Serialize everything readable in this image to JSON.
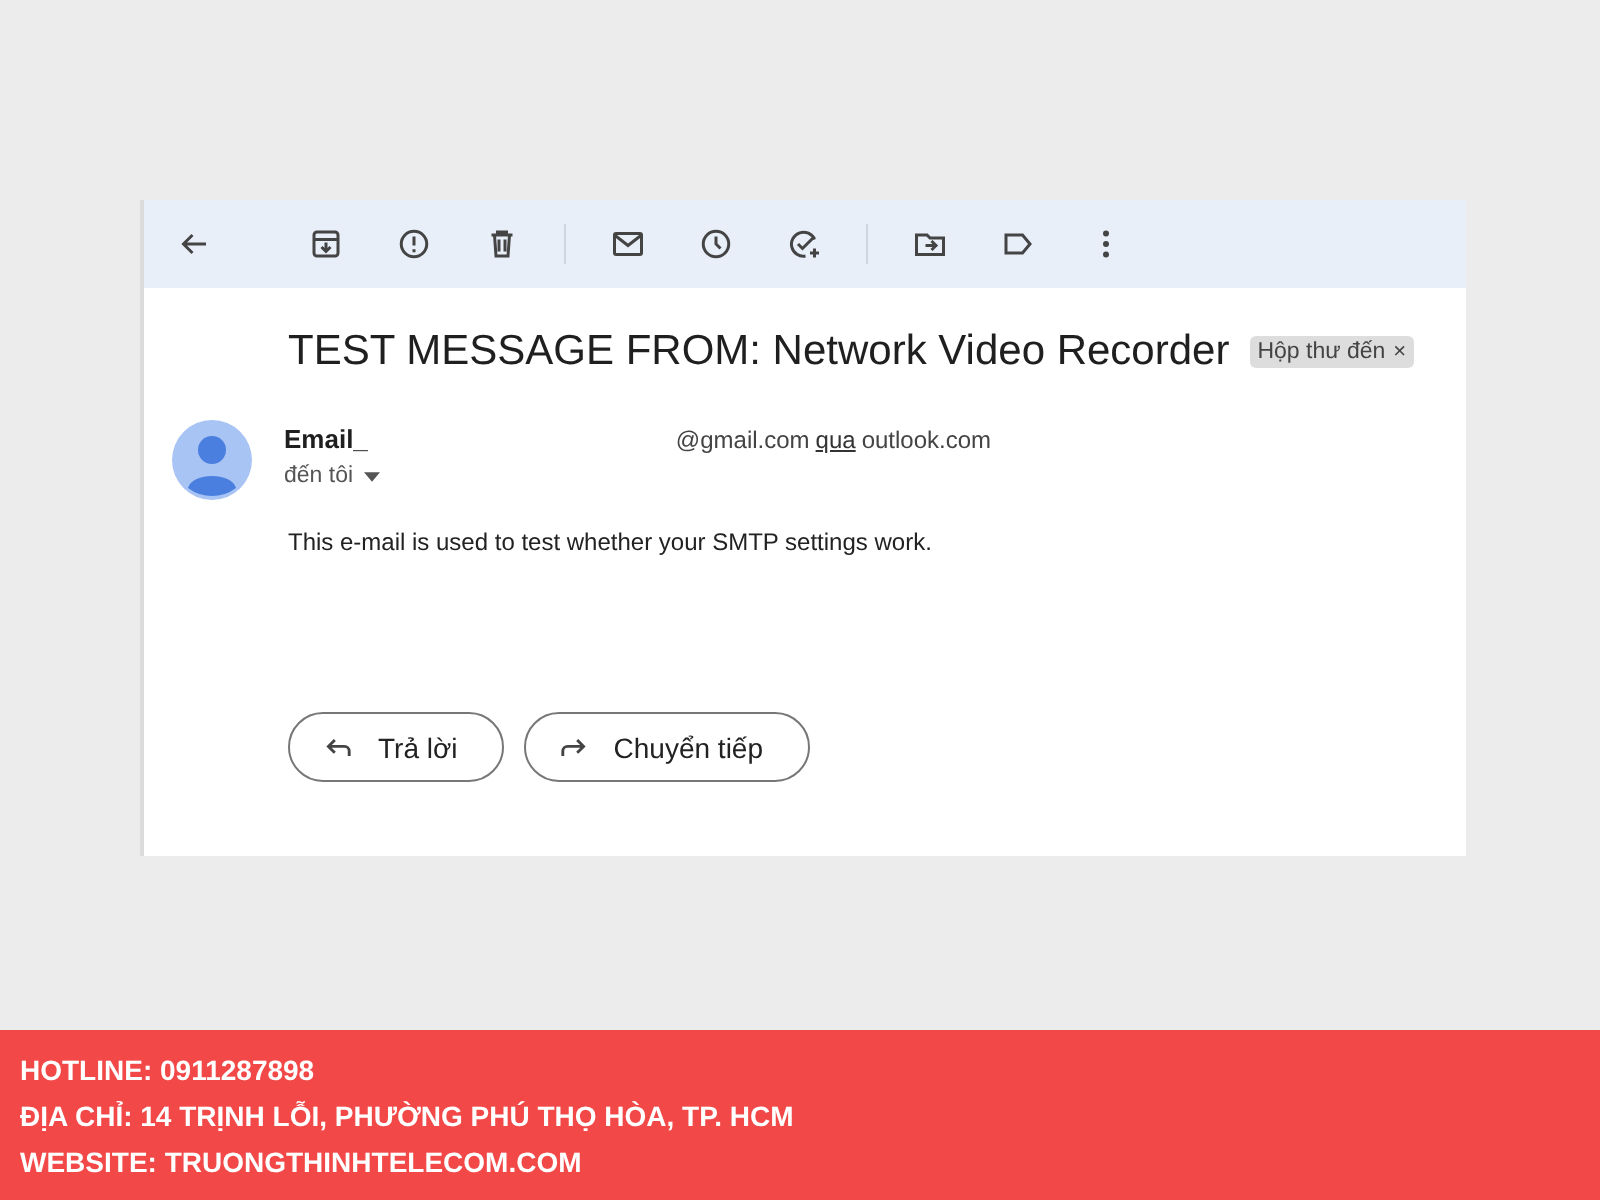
{
  "email": {
    "subject": "TEST MESSAGE FROM: Network Video Recorder",
    "label_chip": {
      "label": "Hộp thư đến",
      "remove": "×"
    },
    "sender": {
      "name": "Email_",
      "address": "@gmail.com",
      "via": "qua",
      "via_domain": "outlook.com"
    },
    "recipient": "đến tôi",
    "body": "This e-mail is used to test whether your SMTP settings work.",
    "actions": [
      {
        "kind": "reply",
        "label": "Trả lời"
      },
      {
        "kind": "forward",
        "label": "Chuyển tiếp"
      }
    ]
  },
  "footer": {
    "lines": [
      "HOTLINE: 0911287898",
      "ĐỊA CHỈ: 14 TRỊNH LỖI, PHƯỜNG PHÚ THỌ HÒA, TP. HCM",
      "WEBSITE: TRUONGTHINHTELECOM.COM"
    ]
  }
}
